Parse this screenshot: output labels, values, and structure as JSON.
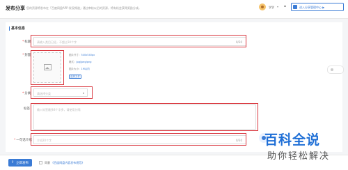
{
  "header": {
    "title": "发布分享",
    "notice": "您的资源将发布在「百度网盘APP-发现频道」通过审核以后的资源，将有机会获得奖励分成。",
    "username": "学学",
    "dropdown": "▾",
    "enter_label": "进入分享管理中心 ▶"
  },
  "section": {
    "title": "基本信息"
  },
  "form": {
    "title_label": "标题",
    "title_placeholder": "请输入类目已经，不超过30个字",
    "title_count": "0/30",
    "cover_label": "封面",
    "spec_size_label": "图片尺寸：",
    "spec_size_value": "540x540px",
    "spec_format_label": "格式：",
    "spec_format_value": "jpg/jpeg/png",
    "spec_file_label": "图片大小：",
    "spec_file_value": "1M以内",
    "choose_button": "选择文件",
    "category_label": "分类",
    "category_placeholder": "请选择分类",
    "category_arrow": "▾",
    "tags_label": "标签",
    "tags_placeholder": "输入标签最多8个字多，请使用分隔",
    "intro_label": "一句话介绍",
    "intro_placeholder": "介绍20个字",
    "intro_count": "0/30"
  },
  "footer": {
    "publish_label": "立即发布",
    "agree_prefix": "同意",
    "agree_link": "《百度网盘内容发布规范》"
  },
  "watermark": {
    "main": "百科全说",
    "sub": "助你轻松解决"
  },
  "colors": {
    "accent": "#3a7bd5",
    "highlight": "#d9363e"
  }
}
